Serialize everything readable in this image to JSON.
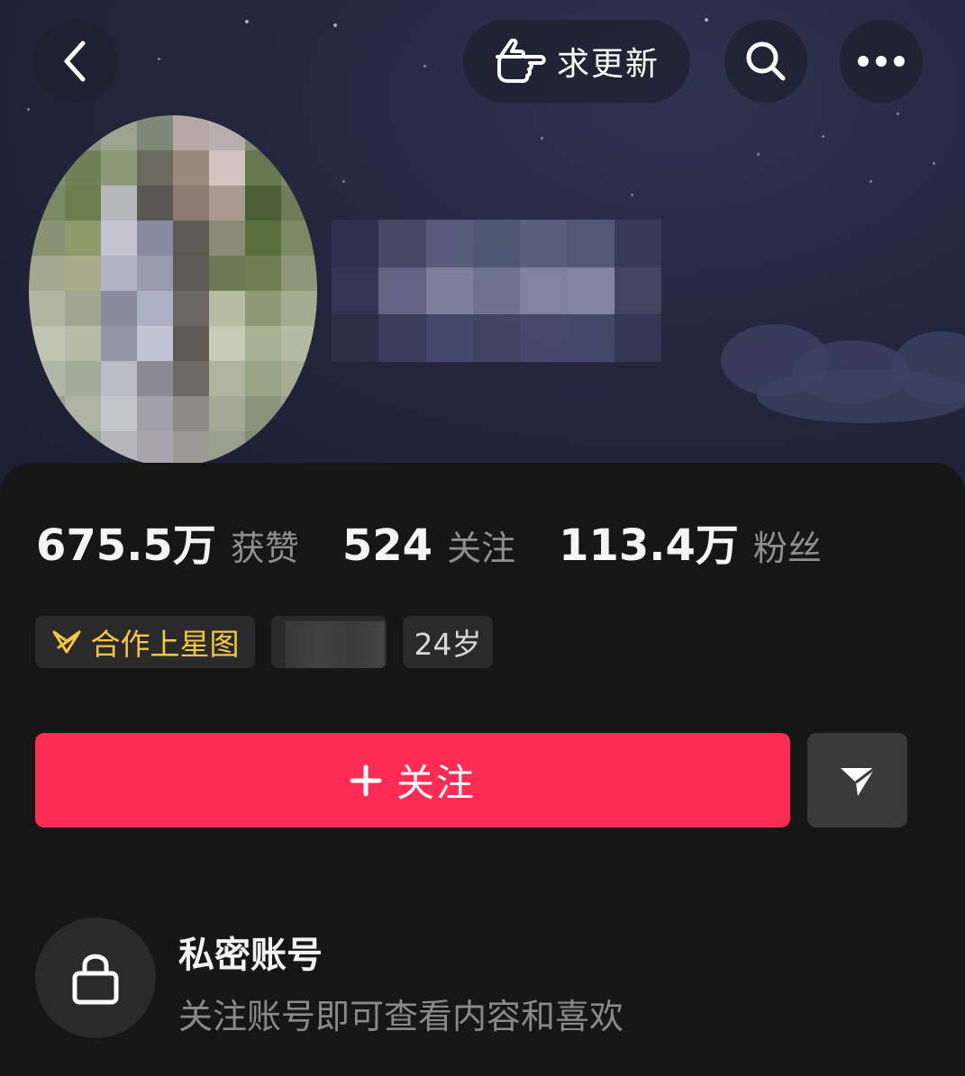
{
  "header": {
    "back_icon": "chevron-left-icon",
    "update_button_label": "求更新",
    "update_icon": "pointing-hand-icon",
    "search_icon": "search-icon",
    "more_icon": "more-dots-icon"
  },
  "stats": [
    {
      "value": "675.5万",
      "label": "获赞"
    },
    {
      "value": "524",
      "label": "关注"
    },
    {
      "value": "113.4万",
      "label": "粉丝"
    }
  ],
  "tags": {
    "star_tag": "合作上星图",
    "star_icon": "xingtu-logo-icon",
    "age_tag": "24岁"
  },
  "actions": {
    "follow_label": "关注",
    "follow_icon": "plus-icon",
    "share_icon": "send-icon"
  },
  "private": {
    "title": "私密账号",
    "description": "关注账号即可查看内容和喜欢",
    "icon": "lock-icon"
  },
  "colors": {
    "accent": "#fe2c55",
    "star_tag_text": "#f5c842",
    "background": "#161616"
  }
}
